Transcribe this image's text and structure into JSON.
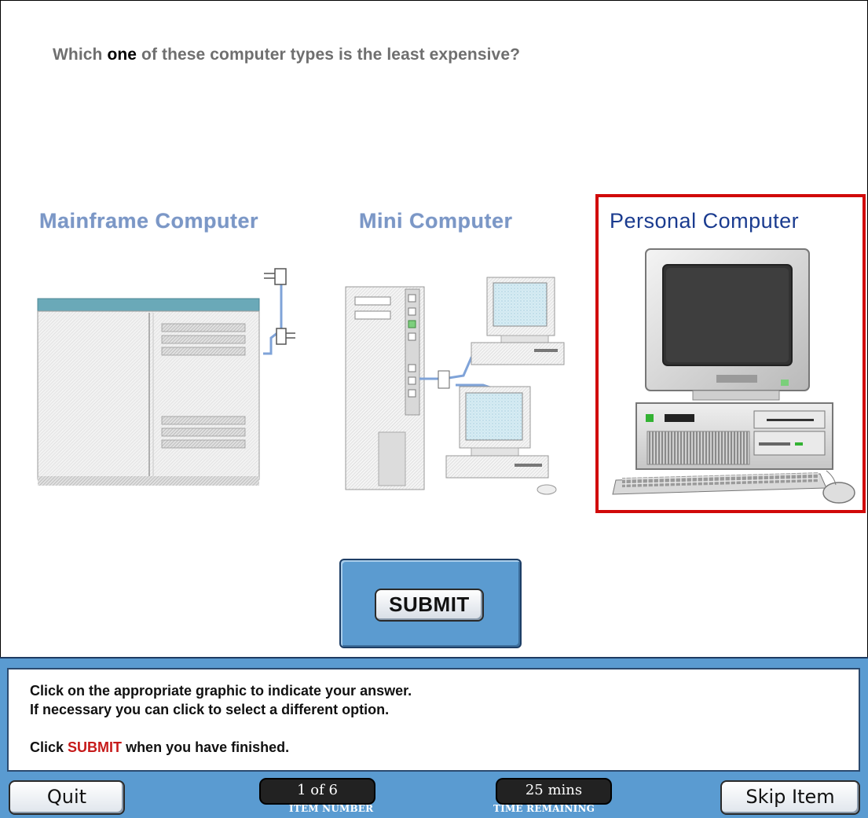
{
  "question": {
    "prefix": "Which",
    "emphasis": "one",
    "suffix": "of these computer types is the least expensive?"
  },
  "options": [
    {
      "label": "Mainframe Computer",
      "selected": false
    },
    {
      "label": "Mini Computer",
      "selected": false
    },
    {
      "label": "Personal Computer",
      "selected": true
    }
  ],
  "submit_label": "SUBMIT",
  "instructions": {
    "line1": "Click on the appropriate graphic to indicate your answer.",
    "line2": "If necessary you can click to select a different option.",
    "line3_pre": "Click",
    "line3_highlight": "SUBMIT",
    "line3_post": "when you have finished."
  },
  "footer": {
    "quit_label": "Quit",
    "skip_label": "Skip Item",
    "item_number": "1 of 6",
    "item_number_label": "ITEM NUMBER",
    "time_remaining": "25 mins",
    "time_remaining_label": "TIME REMAINING"
  },
  "colors": {
    "selection_border": "#d10a0a",
    "panel_blue": "#5a9bd1",
    "highlight_red": "#c61a1a"
  }
}
